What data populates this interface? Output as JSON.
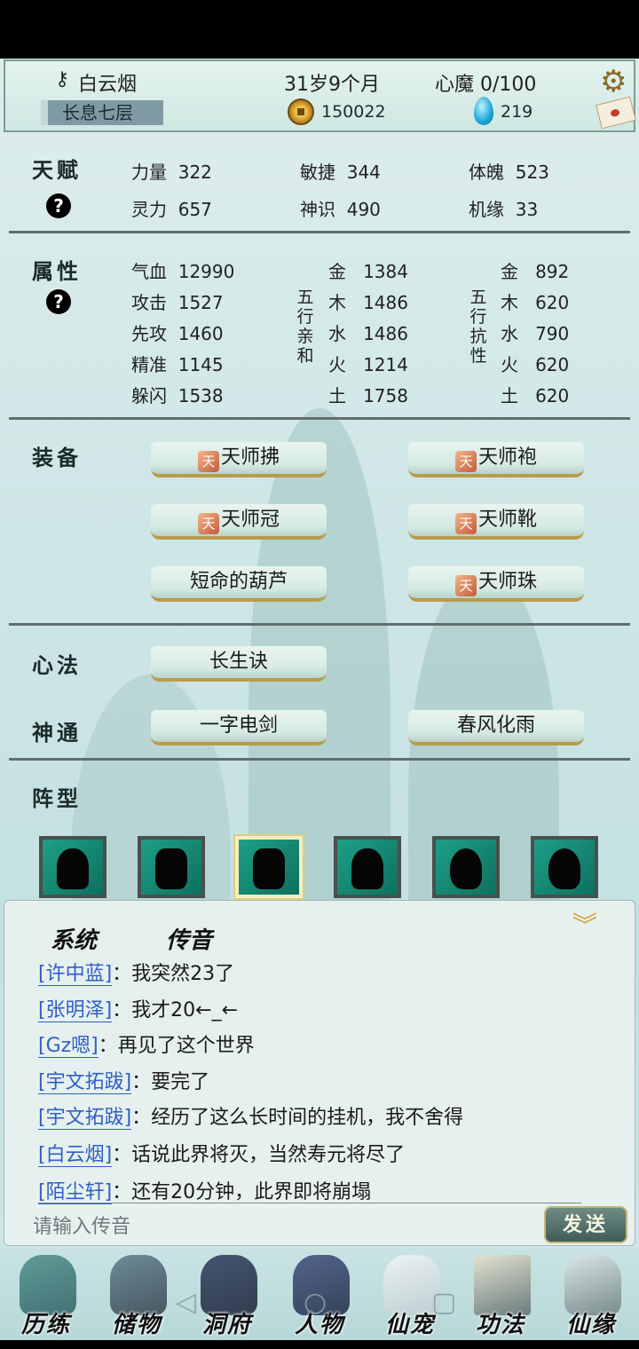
{
  "header": {
    "name": "白云烟",
    "age": "31岁9个月",
    "heart_demon": "心魔 0/100",
    "realm": "长息七层",
    "coins": "150022",
    "gems": "219"
  },
  "talent": {
    "title": "天赋",
    "help": "?",
    "stats": [
      {
        "label": "力量",
        "value": "322"
      },
      {
        "label": "敏捷",
        "value": "344"
      },
      {
        "label": "体魄",
        "value": "523"
      },
      {
        "label": "灵力",
        "value": "657"
      },
      {
        "label": "神识",
        "value": "490"
      },
      {
        "label": "机缘",
        "value": "33"
      }
    ]
  },
  "attributes": {
    "title": "属性",
    "help": "?",
    "basic": [
      {
        "label": "气血",
        "value": "12990"
      },
      {
        "label": "攻击",
        "value": "1527"
      },
      {
        "label": "先攻",
        "value": "1460"
      },
      {
        "label": "精准",
        "value": "1145"
      },
      {
        "label": "躲闪",
        "value": "1538"
      }
    ],
    "affinity_label": [
      "五",
      "行",
      "亲",
      "和"
    ],
    "affinity": [
      {
        "label": "金",
        "value": "1384"
      },
      {
        "label": "木",
        "value": "1486"
      },
      {
        "label": "水",
        "value": "1486"
      },
      {
        "label": "火",
        "value": "1214"
      },
      {
        "label": "土",
        "value": "1758"
      }
    ],
    "resist_label": [
      "五",
      "行",
      "抗",
      "性"
    ],
    "resist": [
      {
        "label": "金",
        "value": "892"
      },
      {
        "label": "木",
        "value": "620"
      },
      {
        "label": "水",
        "value": "790"
      },
      {
        "label": "火",
        "value": "620"
      },
      {
        "label": "土",
        "value": "620"
      }
    ]
  },
  "equipment": {
    "title": "装备",
    "items": [
      {
        "label": "天师拂",
        "icon": "talisman-icon"
      },
      {
        "label": "天师袍",
        "icon": "talisman-icon"
      },
      {
        "label": "天师冠",
        "icon": "talisman-icon"
      },
      {
        "label": "天师靴",
        "icon": "talisman-icon"
      },
      {
        "label": "短命的葫芦",
        "icon": ""
      },
      {
        "label": "天师珠",
        "icon": "talisman-icon"
      }
    ],
    "icon_glyph": "天"
  },
  "mind_method": {
    "title": "心法",
    "item": "长生诀"
  },
  "divine": {
    "title": "神通",
    "items": [
      "一字电剑",
      "春风化雨"
    ]
  },
  "formation": {
    "title": "阵型"
  },
  "chat": {
    "tabs": [
      "系统",
      "传音"
    ],
    "collapse_icon": "double-chevron-down-icon",
    "messages": [
      {
        "name": "[许中蓝]",
        "text": "：我突然23了"
      },
      {
        "name": "[张明泽]",
        "text": "：我才20←_←"
      },
      {
        "name": "[Gz嗯]",
        "text": "：再见了这个世界"
      },
      {
        "name": "[宇文拓跋]",
        "text": "：要完了"
      },
      {
        "name": "[宇文拓跋]",
        "text": "：经历了这么长时间的挂机，我不舍得"
      },
      {
        "name": "[白云烟]",
        "text": "：话说此界将灭，当然寿元将尽了"
      },
      {
        "name": "[陌尘轩]",
        "text": "：还有20分钟，此界即将崩塌"
      }
    ],
    "input_placeholder": "请输入传音",
    "send_label": "发送"
  },
  "nav": [
    "历练",
    "储物",
    "洞府",
    "人物",
    "仙宠",
    "功法",
    "仙缘"
  ]
}
